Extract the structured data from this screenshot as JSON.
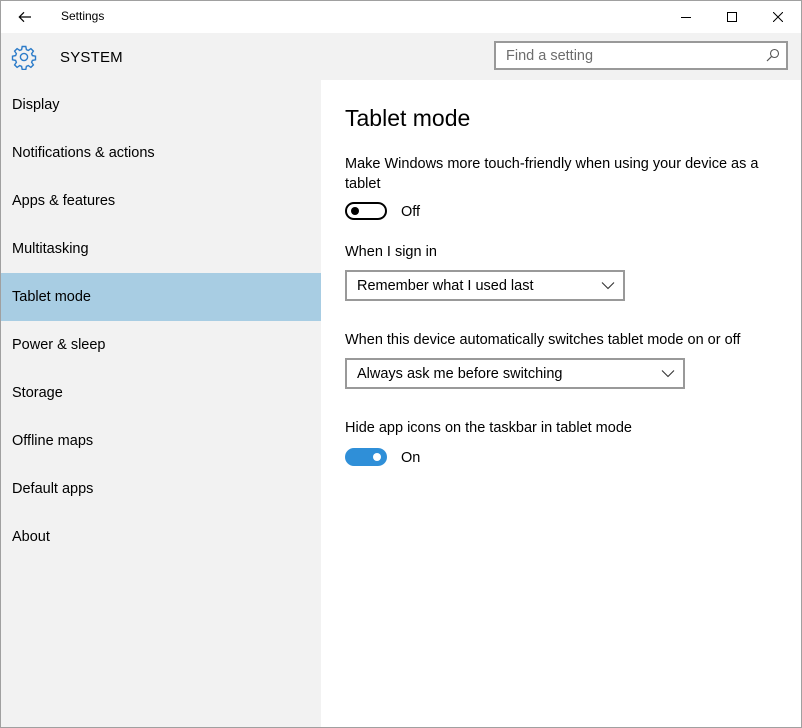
{
  "window": {
    "title": "Settings"
  },
  "header": {
    "section": "SYSTEM",
    "search_placeholder": "Find a setting"
  },
  "sidebar": {
    "items": [
      {
        "label": "Display"
      },
      {
        "label": "Notifications & actions"
      },
      {
        "label": "Apps & features"
      },
      {
        "label": "Multitasking"
      },
      {
        "label": "Tablet mode",
        "active": true
      },
      {
        "label": "Power & sleep"
      },
      {
        "label": "Storage"
      },
      {
        "label": "Offline maps"
      },
      {
        "label": "Default apps"
      },
      {
        "label": "About"
      }
    ]
  },
  "main": {
    "title": "Tablet mode",
    "touch_description": "Make Windows more touch-friendly when using your device as a tablet",
    "touch_toggle_state": "Off",
    "signin_label": "When I sign in",
    "signin_value": "Remember what I used last",
    "switch_label": "When this device automatically switches tablet mode on or off",
    "switch_value": "Always ask me before switching",
    "hide_icons_label": "Hide app icons on the taskbar in tablet mode",
    "hide_icons_state": "On"
  },
  "colors": {
    "accent": "#2f8fd8",
    "selected_nav": "#a8cde3",
    "panel": "#f2f2f2"
  },
  "icons": {
    "back": "back-arrow-icon",
    "minimize": "minimize-icon",
    "maximize": "maximize-icon",
    "close": "close-icon",
    "section": "gear-icon",
    "search": "search-icon",
    "dropdown": "chevron-down-icon"
  }
}
